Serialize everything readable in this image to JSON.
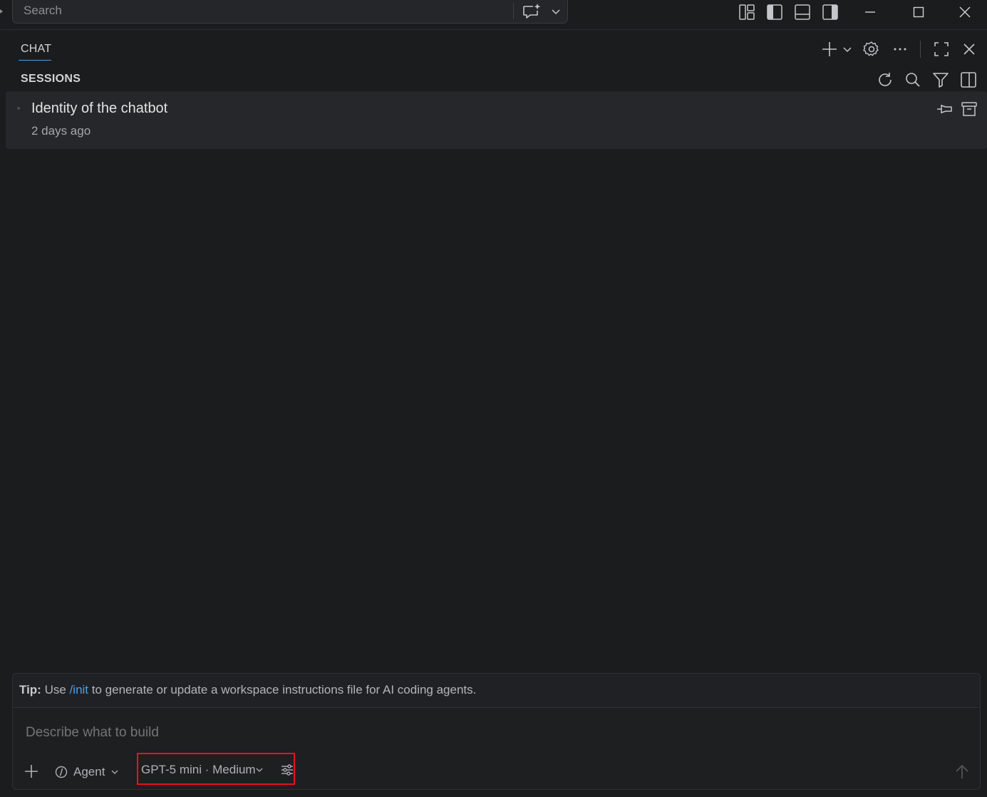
{
  "titlebar": {
    "search_placeholder": "Search"
  },
  "chat": {
    "tab_label": "CHAT",
    "sessions_title": "SESSIONS",
    "sessions": [
      {
        "title": "Identity of the chatbot",
        "time": "2 days ago"
      }
    ]
  },
  "input": {
    "tip_label": "Tip:",
    "tip_pre": "Use",
    "tip_command": "/init",
    "tip_post": "to generate or update a workspace instructions file for AI coding agents.",
    "placeholder": "Describe what to build",
    "mode_label": "Agent",
    "model_label": "GPT-5 mini · Medium"
  },
  "colors": {
    "accent": "#4aa1e6",
    "highlight_border": "#e81123",
    "background": "#1b1c1e"
  }
}
